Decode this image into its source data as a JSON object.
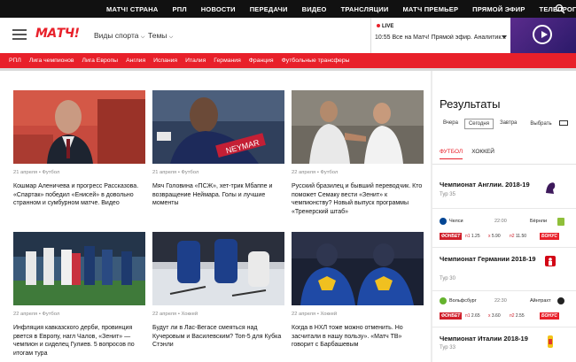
{
  "topbar": {
    "links": [
      "МАТЧ! СТРАНА",
      "РПЛ",
      "НОВОСТИ",
      "ПЕРЕДАЧИ",
      "ВИДЕО",
      "ТРАНСЛЯЦИИ",
      "МАТЧ ПРЕМЬЕР",
      "ПРЯМОЙ ЭФИР",
      "ТЕЛЕПРОГРАММА"
    ]
  },
  "header": {
    "logo": "МАТЧ!",
    "sports_dropdown": "Виды спорта",
    "themes_dropdown": "Темы",
    "live_label": "LIVE",
    "live_text": "10:55 Все на Матч! Прямой эфир. Аналитик..."
  },
  "rednav": [
    "РПЛ",
    "Лига чемпионов",
    "Лига Европы",
    "Англия",
    "Испания",
    "Италия",
    "Германия",
    "Франция",
    "Футбольные трансферы"
  ],
  "articles": [
    {
      "date": "21 апреля",
      "sport": "Футбол",
      "title": "Кошмар Аленичева и прогресс Рассказова. «Спартак» победил «Енисей» в довольно странном и сумбурном матче. Видео"
    },
    {
      "date": "21 апреля",
      "sport": "Футбол",
      "title": "Мяч Головина «ПСЖ», хет-трик Мбаппе и возвращение Неймара. Голы и лучшие моменты"
    },
    {
      "date": "22 апреля",
      "sport": "Футбол",
      "title": "Русский бразилец и бывший переводчик. Кто поможет Семаку вести «Зенит» к чемпионству? Новый выпуск программы «Тренерский штаб»"
    },
    {
      "date": "22 апреля",
      "sport": "Футбол",
      "title": "Инфляция кавказского дерби, провинция рвется в Европу, нагл Чалов, «Зенит» — чемпион и сиделец Гулиев. 5 вопросов по итогам тура"
    },
    {
      "date": "22 апреля",
      "sport": "Хоккей",
      "title": "Будут ли в Лас-Вегасе смеяться над Кучеровым и Василевским? Топ-5 для Кубка Стэнли"
    },
    {
      "date": "22 апреля",
      "sport": "Хоккей",
      "title": "Когда в НХЛ тоже можно отменить. Но засчитали в нашу пользу». «Матч ТВ» говорит с Барбашевым"
    }
  ],
  "sidebar": {
    "title": "Результаты",
    "days": [
      "Вчера",
      "Сегодня",
      "Завтра",
      "Выбрать"
    ],
    "sports": [
      "ФУТБОЛ",
      "ХОККЕЙ"
    ],
    "leagues": [
      {
        "name": "Чемпионат Англии. 2018-19",
        "tour": "Тур 35",
        "match": {
          "home": "Челси",
          "time": "22:00",
          "away": "Бёрнли"
        },
        "odds": {
          "bookmaker": "ФОНБЕТ",
          "p1": "1.25",
          "x": "5.90",
          "p2": "11.50",
          "bonus": "БОНУС"
        }
      },
      {
        "name": "Чемпионат Германии 2018-19",
        "tour": "Тур 30",
        "match": {
          "home": "Вольфсбург",
          "time": "22:30",
          "away": "Айнтрахт"
        },
        "odds": {
          "bookmaker": "ФОНБЕТ",
          "p1": "2.65",
          "x": "3.60",
          "p2": "2.55",
          "bonus": "БОНУС"
        }
      },
      {
        "name": "Чемпионат Италии 2018-19",
        "tour": "Тур 33"
      }
    ]
  },
  "colors": {
    "brand_red": "#e8202a",
    "topbar": "#111111",
    "live_purple": "#5a2b8c"
  }
}
